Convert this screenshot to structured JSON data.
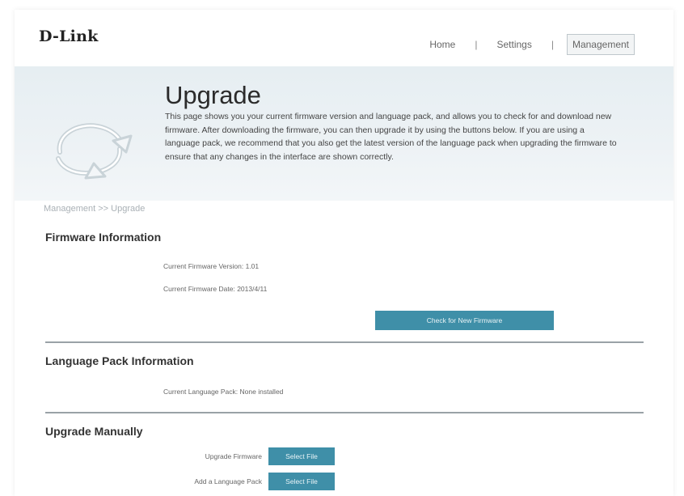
{
  "header": {
    "logo": "D-Link",
    "nav": [
      {
        "label": "Home"
      },
      {
        "label": "Settings"
      },
      {
        "label": "Management",
        "active": true
      }
    ]
  },
  "banner": {
    "title": "Upgrade",
    "description": "This page shows you your current firmware version and language pack, and allows you to check for and download new firmware. After downloading the firmware, you can then upgrade it by using the buttons below. If you are using a language pack, we recommend that you also get the latest version of the language pack when upgrading the firmware to ensure that any changes in the interface are shown correctly.",
    "icon": "refresh-arrows-icon"
  },
  "breadcrumb": "Management >> Upgrade",
  "firmware": {
    "title": "Firmware Information",
    "version_label": "Current Firmware Version:",
    "version_value": "1.01",
    "date_label": "Current Firmware Date:",
    "date_value": "2013/4/11",
    "check_button": "Check for New Firmware"
  },
  "language": {
    "title": "Language Pack Information",
    "pack_label": "Current Language Pack:",
    "pack_value": "None installed"
  },
  "manual": {
    "title": "Upgrade Manually",
    "firmware_label": "Upgrade Firmware",
    "firmware_button": "Select File",
    "language_label": "Add a Language Pack",
    "language_button": "Select File"
  },
  "colors": {
    "accent": "#3f8fa8",
    "banner_bg": "#e6eef2",
    "divider": "#9aa2a7"
  }
}
